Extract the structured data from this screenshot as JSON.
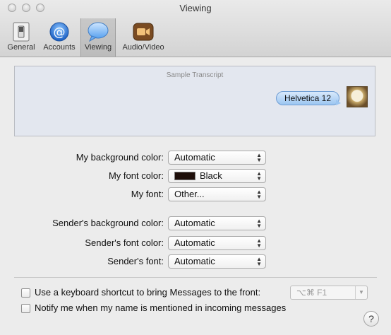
{
  "window": {
    "title": "Viewing"
  },
  "toolbar": {
    "items": [
      {
        "label": "General",
        "icon": "switch-icon",
        "active": false
      },
      {
        "label": "Accounts",
        "icon": "at-sign-icon",
        "active": false
      },
      {
        "label": "Viewing",
        "icon": "speech-bubble-icon",
        "active": true
      },
      {
        "label": "Audio/Video",
        "icon": "video-camera-icon",
        "active": false
      }
    ]
  },
  "preview": {
    "title": "Sample Transcript",
    "bubble_text": "Helvetica 12"
  },
  "settings": {
    "my_background_color": {
      "label": "My background color:",
      "value": "Automatic"
    },
    "my_font_color": {
      "label": "My font color:",
      "value": "Black",
      "swatch": "#1e0f0a"
    },
    "my_font": {
      "label": "My font:",
      "value": "Other..."
    },
    "sender_background_color": {
      "label": "Sender's background color:",
      "value": "Automatic"
    },
    "sender_font_color": {
      "label": "Sender's font color:",
      "value": "Automatic"
    },
    "sender_font": {
      "label": "Sender's font:",
      "value": "Automatic"
    }
  },
  "options": {
    "shortcut": {
      "label": "Use a keyboard shortcut to bring Messages to the front:",
      "value": "⌥⌘ F1",
      "checked": false
    },
    "notify": {
      "label": "Notify me when my name is mentioned in incoming messages",
      "checked": false
    }
  },
  "help": {
    "label": "?"
  }
}
